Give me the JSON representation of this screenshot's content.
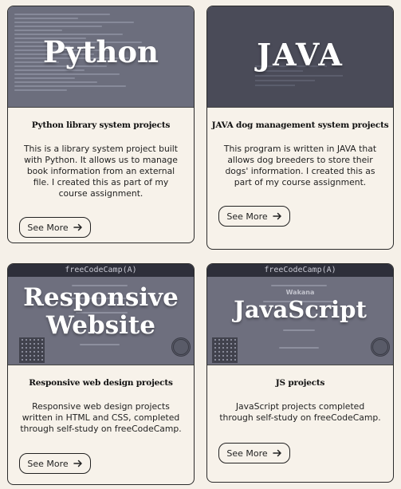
{
  "see_more_label": "See More",
  "cards": [
    {
      "overlay": "Python",
      "title": "Python library system projects",
      "description": "This is a library system project built with Python. It allows us to manage book information from an external file. I created this as part of my course assignment."
    },
    {
      "overlay": "JAVA",
      "title": "JAVA dog management system projects",
      "description": "This program is written in JAVA that allows dog breeders to store their dogs' information. I created this as part of my course assignment."
    },
    {
      "overlay_line1": "Responsive",
      "overlay_line2": "Website",
      "banner": "freeCodeCamp(A)",
      "title": "Responsive web design projects",
      "description": "Responsive web design projects written in HTML and CSS, completed through self-study on freeCodeCamp."
    },
    {
      "overlay": "JavaScript",
      "banner": "freeCodeCamp(A)",
      "cert_name": "Wakana",
      "title": "JS projects",
      "description": "JavaScript projects completed through self-study on freeCodeCamp."
    }
  ],
  "colors": {
    "page_bg": "#f5f0e8",
    "card_bg": "#f7f2ea",
    "border": "#2b2b2b"
  }
}
